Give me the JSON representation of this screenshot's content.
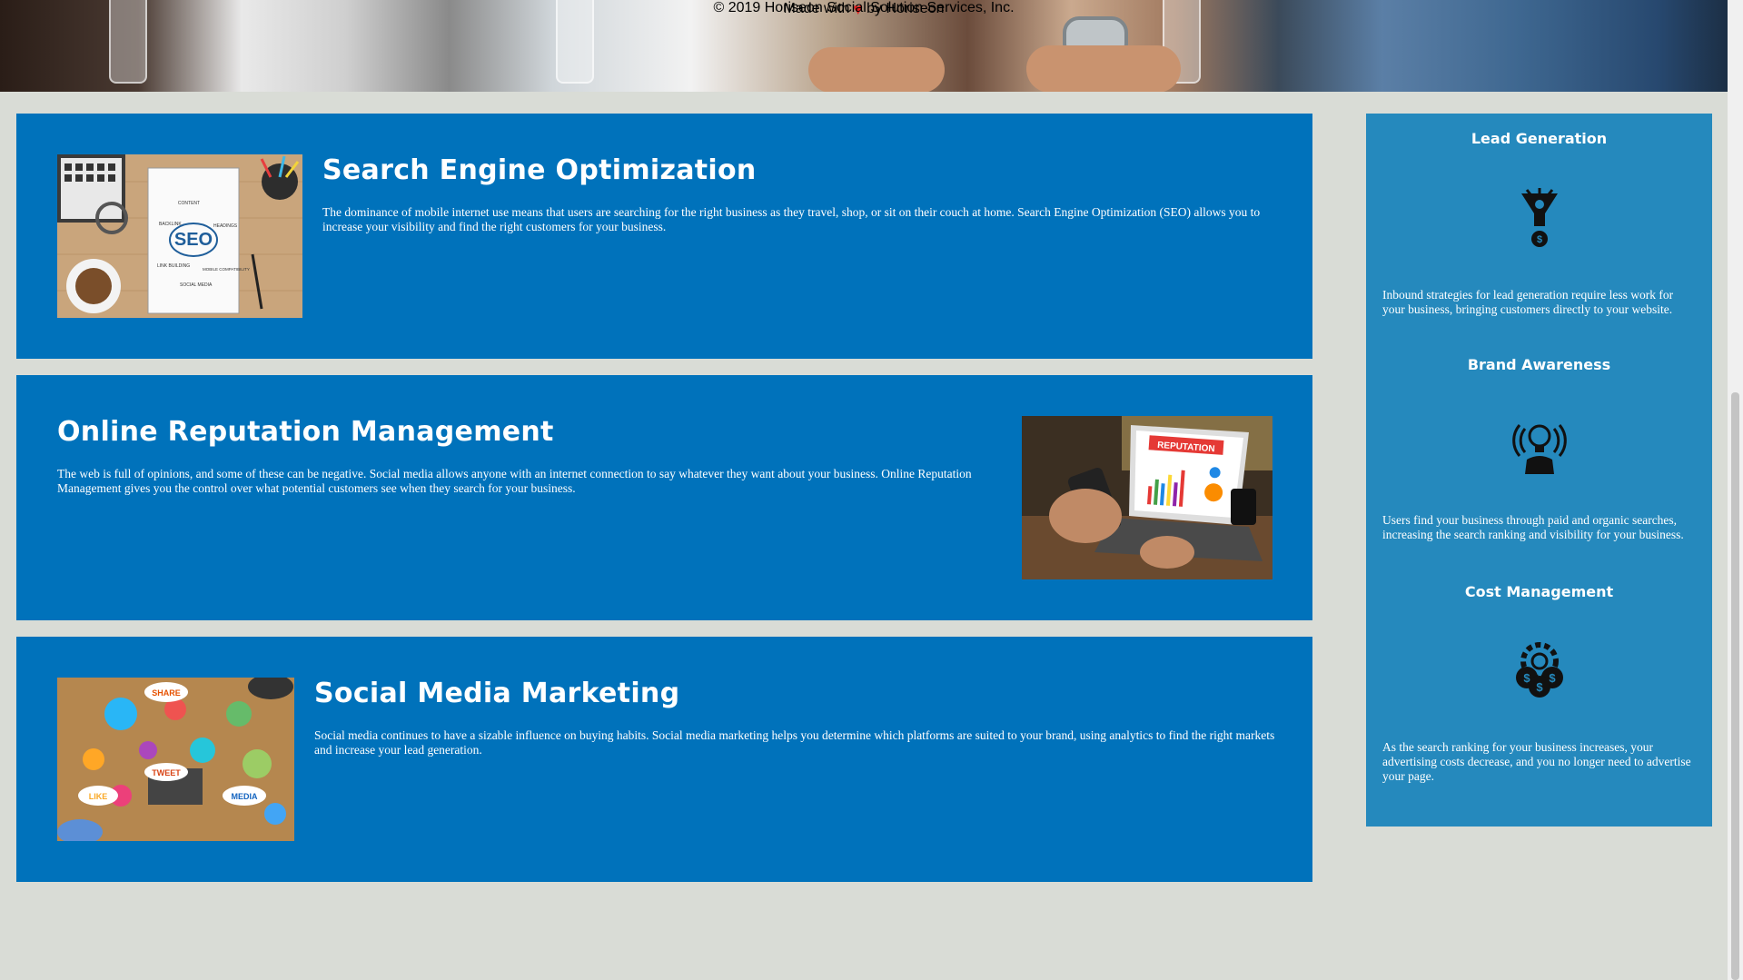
{
  "sections": [
    {
      "title": "Search Engine Optimization",
      "text": "The dominance of mobile internet use means that users are searching for the right business as they travel, shop, or sit on their couch at home. Search Engine Optimization (SEO) allows you to increase your visibility and find the right customers for your business.",
      "image_label": "SEO",
      "image_words": [
        "CONTENT",
        "BACKLINK",
        "HEADINGS",
        "LINK BUILDING",
        "MOBILE COMPATIBILITY",
        "SOCIAL MEDIA"
      ]
    },
    {
      "title": "Online Reputation Management",
      "text": "The web is full of opinions, and some of these can be negative. Social media allows anyone with an internet connection to say whatever they want about your business. Online Reputation Management gives you the control over what potential customers see when they search for your business.",
      "image_label": "REPUTATION"
    },
    {
      "title": "Social Media Marketing",
      "text": "Social media continues to have a sizable influence on buying habits. Social media marketing helps you determine which platforms are suited to your brand, using analytics to find the right markets and increase your lead generation.",
      "image_words": [
        "SHARE",
        "TWEET",
        "LIKE",
        "MEDIA"
      ]
    }
  ],
  "benefits": [
    {
      "title": "Lead Generation",
      "icon": "lead-generation-icon",
      "text": "Inbound strategies for lead generation require less work for your business, bringing customers directly to your website."
    },
    {
      "title": "Brand Awareness",
      "icon": "brand-awareness-icon",
      "text": "Users find your business through paid and organic searches, increasing the search ranking and visibility for your business."
    },
    {
      "title": "Cost Management",
      "icon": "cost-management-icon",
      "text": "As the search ranking for your business increases, your advertising costs decrease, and you no longer need to advertise your page."
    }
  ],
  "footer": {
    "made_with": "Made with",
    "by": "by Horiseon",
    "copyright": "© 2019 Horiseon Social Solution Services, Inc."
  },
  "colors": {
    "page_background": "#d9dcd6",
    "section_background": "#0072bb",
    "sidebar_background": "#2589bd",
    "heart": "#e01e1e"
  }
}
